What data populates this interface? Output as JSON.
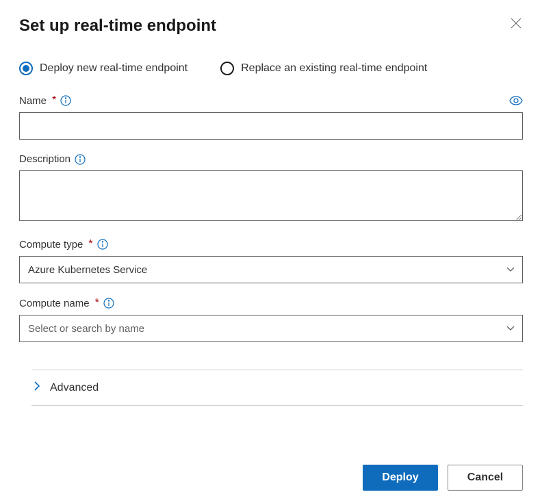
{
  "title": "Set up real-time endpoint",
  "radio": {
    "deploy_new": "Deploy new real-time endpoint",
    "replace_existing": "Replace an existing real-time endpoint"
  },
  "fields": {
    "name": {
      "label": "Name",
      "value": ""
    },
    "description": {
      "label": "Description",
      "value": ""
    },
    "compute_type": {
      "label": "Compute type",
      "value": "Azure Kubernetes Service"
    },
    "compute_name": {
      "label": "Compute name",
      "placeholder": "Select or search by name"
    }
  },
  "advanced": {
    "label": "Advanced"
  },
  "buttons": {
    "deploy": "Deploy",
    "cancel": "Cancel"
  }
}
